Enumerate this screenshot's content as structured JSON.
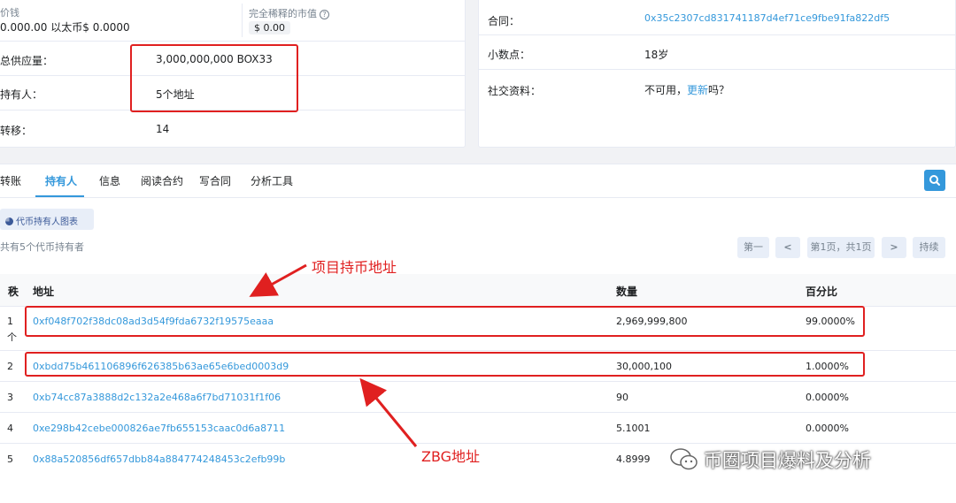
{
  "overview": {
    "price_label": "价钱",
    "price_value": "0.000.00 以太币$ 0.0000",
    "fdmc_label": "完全稀释的市值",
    "fdmc_value": "$ 0.00",
    "supply_label": "总供应量：",
    "supply_value": "3,000,000,000 BOX33",
    "holders_label": "持有人：",
    "holders_value": "5个地址",
    "transfers_label": "转移：",
    "transfers_value": "14"
  },
  "profile": {
    "contract_label": "合同：",
    "contract_value": "0x35c2307cd831741187d4ef71ce9fbe91fa822df5",
    "decimals_label": "小数点：",
    "decimals_value": "18岁",
    "social_label": "社交资料：",
    "social_text": "不可用，",
    "social_link": "更新",
    "social_suffix": "吗？"
  },
  "tabs": [
    "转账",
    "持有人",
    "信息",
    "阅读合约",
    "写合同",
    "分析工具"
  ],
  "chart_button": "代币持有人图表",
  "holders_summary": "共有5个代币持有者",
  "pagination": {
    "first": "第一",
    "prev": "<",
    "page": "第1页，共1页",
    "next": ">",
    "last": "持续"
  },
  "table": {
    "headers": [
      "秩",
      "地址",
      "数量",
      "百分比"
    ],
    "rows": [
      {
        "rank": "1",
        "rank_extra": "个",
        "address": "0xf048f702f38dc08ad3d54f9fda6732f19575eaaa",
        "quantity": "2,969,999,800",
        "percent": "99.0000%"
      },
      {
        "rank": "2",
        "address": "0xbdd75b461106896f626385b63ae65e6bed0003d9",
        "quantity": "30,000,100",
        "percent": "1.0000%"
      },
      {
        "rank": "3",
        "address": "0xb74cc87a3888d2c132a2e468a6f7bd71031f1f06",
        "quantity": "90",
        "percent": "0.0000%"
      },
      {
        "rank": "4",
        "address": "0xe298b42cebe000826ae7fb655153caac0d6a8711",
        "quantity": "5.1001",
        "percent": "0.0000%"
      },
      {
        "rank": "5",
        "address": "0x88a520856df657dbb84a884774248453c2efb99b",
        "quantity": "4.8999",
        "percent": "0.0000%"
      }
    ]
  },
  "annotations": {
    "project_label": "项目持币地址",
    "zbg_label": "ZBG地址",
    "watermark": "币圈项目爆料及分析"
  },
  "colors": {
    "accent": "#3498db",
    "annotation_red": "#e02020"
  }
}
